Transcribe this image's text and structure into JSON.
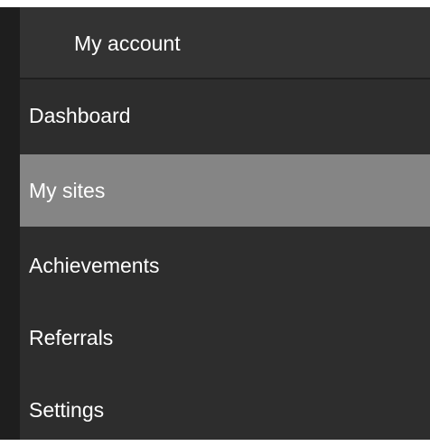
{
  "header": {
    "title": "My account"
  },
  "menu": {
    "items": [
      {
        "label": "Dashboard",
        "active": false
      },
      {
        "label": "My sites",
        "active": true
      },
      {
        "label": "Achievements",
        "active": false
      },
      {
        "label": "Referrals",
        "active": false
      },
      {
        "label": "Settings",
        "active": false
      }
    ]
  },
  "colors": {
    "background": "#2d2d2d",
    "active_item": "#858585",
    "text": "#ffffff"
  }
}
